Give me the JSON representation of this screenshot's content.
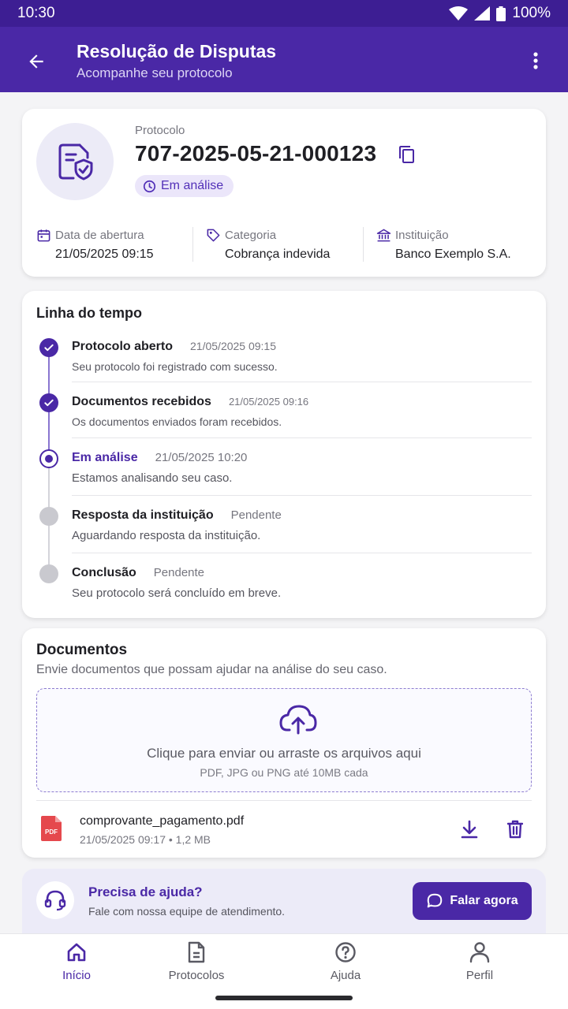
{
  "status_bar": {
    "time": "10:30",
    "battery": "100%"
  },
  "app_bar": {
    "title": "Resolução de Disputas",
    "subtitle": "Acompanhe seu protocolo"
  },
  "protocol": {
    "label": "Protocolo",
    "number": "707-2025-05-21-000123",
    "status": "Em análise",
    "meta": [
      {
        "icon": "calendar-icon",
        "label": "Data de abertura",
        "value": "21/05/2025 09:15"
      },
      {
        "icon": "tag-icon",
        "label": "Categoria",
        "value": "Cobrança indevida"
      },
      {
        "icon": "bank-icon",
        "label": "Instituição",
        "value": "Banco Exemplo S.A."
      }
    ]
  },
  "timeline": {
    "title": "Linha do tempo",
    "items": [
      {
        "title": "Protocolo aberto",
        "date": "21/05/2025 09:15",
        "desc": "Seu protocolo foi registrado com sucesso.",
        "state": "done"
      },
      {
        "title": "Documentos recebidos",
        "date": "21/05/2025 09:16",
        "desc": "Os documentos enviados foram recebidos.",
        "state": "done"
      },
      {
        "title": "Em análise",
        "date": "21/05/2025 10:20",
        "desc": "Estamos analisando seu caso.",
        "state": "current"
      },
      {
        "title": "Resposta da instituição",
        "date": "Pendente",
        "desc": "Aguardando resposta da instituição.",
        "state": "pending"
      },
      {
        "title": "Conclusão",
        "date": "Pendente",
        "desc": "Seu protocolo será concluído em breve.",
        "state": "pending"
      }
    ]
  },
  "documents": {
    "title": "Documentos",
    "subtitle": "Envie documentos que possam ajudar na análise do seu caso.",
    "dropzone_text": "Clique para enviar ou arraste os arquivos aqui",
    "dropzone_hint": "PDF, JPG ou PNG até 10MB cada",
    "files": [
      {
        "name": "comprovante_pagamento.pdf",
        "meta": "21/05/2025 09:17 • 1,2 MB",
        "type_label": "PDF"
      }
    ]
  },
  "help": {
    "title": "Precisa de ajuda?",
    "subtitle": "Fale com nossa equipe de atendimento.",
    "button": "Falar agora"
  },
  "bottom_nav": [
    {
      "label": "Início",
      "icon": "home-icon",
      "active": true
    },
    {
      "label": "Protocolos",
      "icon": "document-icon",
      "active": false
    },
    {
      "label": "Ajuda",
      "icon": "help-icon",
      "active": false
    },
    {
      "label": "Perfil",
      "icon": "person-icon",
      "active": false
    }
  ],
  "colors": {
    "primary": "#4a28a6",
    "primary_dark": "#3d1e93",
    "chip_bg": "#ebe6fa",
    "pending": "#c9c9cf",
    "pdf_red": "#e5484d"
  }
}
